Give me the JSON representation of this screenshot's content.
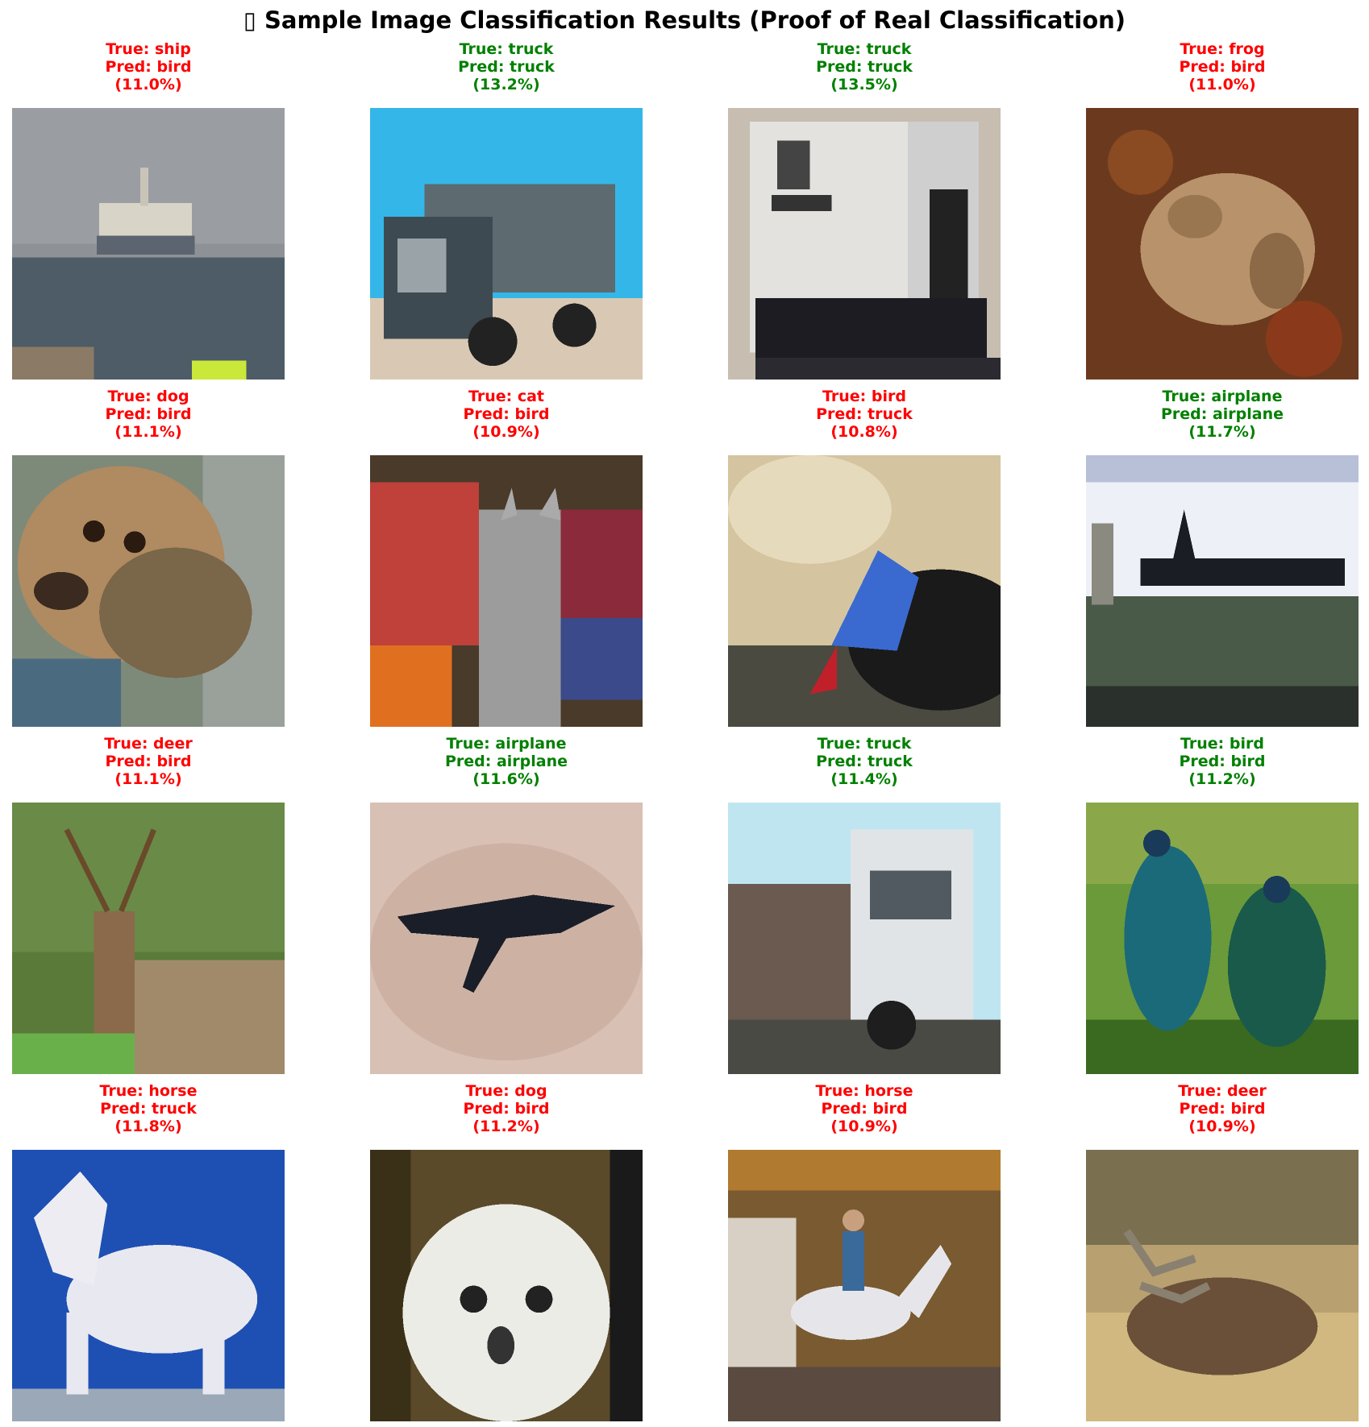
{
  "figure": {
    "title": "▯ Sample Image Classification Results (Proof of Real Classification)",
    "colors": {
      "correct": "#008000",
      "wrong": "#ff0000"
    }
  },
  "samples": [
    {
      "true_line": "True: ship",
      "pred_line": "Pred: bird",
      "conf": "(11.0%)",
      "correct": false,
      "scene": "ship"
    },
    {
      "true_line": "True: truck",
      "pred_line": "Pred: truck",
      "conf": "(13.2%)",
      "correct": true,
      "scene": "truck-blue"
    },
    {
      "true_line": "True: truck",
      "pred_line": "Pred: truck",
      "conf": "(13.5%)",
      "correct": true,
      "scene": "truck-white"
    },
    {
      "true_line": "True: frog",
      "pred_line": "Pred: bird",
      "conf": "(11.0%)",
      "correct": false,
      "scene": "frog"
    },
    {
      "true_line": "True: dog",
      "pred_line": "Pred: bird",
      "conf": "(11.1%)",
      "correct": false,
      "scene": "dog"
    },
    {
      "true_line": "True: cat",
      "pred_line": "Pred: bird",
      "conf": "(10.9%)",
      "correct": false,
      "scene": "cat"
    },
    {
      "true_line": "True: bird",
      "pred_line": "Pred: truck",
      "conf": "(10.8%)",
      "correct": false,
      "scene": "bird-blue"
    },
    {
      "true_line": "True: airplane",
      "pred_line": "Pred: airplane",
      "conf": "(11.7%)",
      "correct": true,
      "scene": "airplane-ground"
    },
    {
      "true_line": "True: deer",
      "pred_line": "Pred: bird",
      "conf": "(11.1%)",
      "correct": false,
      "scene": "deer"
    },
    {
      "true_line": "True: airplane",
      "pred_line": "Pred: airplane",
      "conf": "(11.6%)",
      "correct": true,
      "scene": "airplane-sky"
    },
    {
      "true_line": "True: truck",
      "pred_line": "Pred: truck",
      "conf": "(11.4%)",
      "correct": true,
      "scene": "truck-cab"
    },
    {
      "true_line": "True: bird",
      "pred_line": "Pred: bird",
      "conf": "(11.2%)",
      "correct": true,
      "scene": "bird-green"
    },
    {
      "true_line": "True: horse",
      "pred_line": "Pred: truck",
      "conf": "(11.8%)",
      "correct": false,
      "scene": "horse-white"
    },
    {
      "true_line": "True: dog",
      "pred_line": "Pred: bird",
      "conf": "(11.2%)",
      "correct": false,
      "scene": "puppy"
    },
    {
      "true_line": "True: horse",
      "pred_line": "Pred: bird",
      "conf": "(10.9%)",
      "correct": false,
      "scene": "horse-rider"
    },
    {
      "true_line": "True: deer",
      "pred_line": "Pred: bird",
      "conf": "(10.9%)",
      "correct": false,
      "scene": "elk"
    }
  ]
}
